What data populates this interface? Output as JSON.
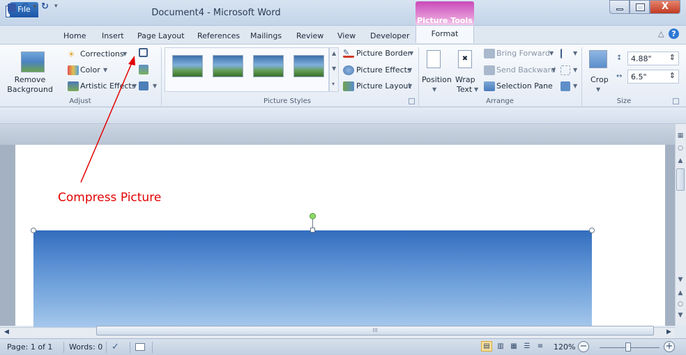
{
  "window": {
    "app_icon": "W",
    "title": "Document4 - Microsoft Word",
    "contextual_tab": "Picture Tools",
    "close_glyph": "X"
  },
  "tabs": [
    "File",
    "Home",
    "Insert",
    "Page Layout",
    "References",
    "Mailings",
    "Review",
    "View",
    "Developer",
    "Format"
  ],
  "ribbon": {
    "adjust": {
      "remove_background": [
        "Remove",
        "Background"
      ],
      "corrections": "Corrections",
      "color": "Color",
      "artistic_effects": "Artistic Effects",
      "label": "Adjust"
    },
    "picture_styles": {
      "picture_border": "Picture Border",
      "picture_effects": "Picture Effects",
      "picture_layout": "Picture Layout",
      "label": "Picture Styles"
    },
    "arrange": {
      "position": "Position",
      "wrap_text": [
        "Wrap",
        "Text"
      ],
      "bring_forward": "Bring Forward",
      "send_backward": "Send Backward",
      "selection_pane": "Selection Pane",
      "label": "Arrange"
    },
    "size": {
      "crop": "Crop",
      "height": "4.88\"",
      "width": "6.5\"",
      "label": "Size"
    }
  },
  "annotation": {
    "text": "Compress Picture",
    "color": "#e20000"
  },
  "statusbar": {
    "page": "Page: 1 of 1",
    "words": "Words: 0",
    "zoom": "120%",
    "zoom_minus": "−",
    "zoom_plus": "+"
  },
  "scroll_grip": "III",
  "colors": {
    "file_tab": "#2a65b4",
    "contextual_tab": "#d35fc6",
    "ribbon_bg": "#f3f6fb"
  }
}
